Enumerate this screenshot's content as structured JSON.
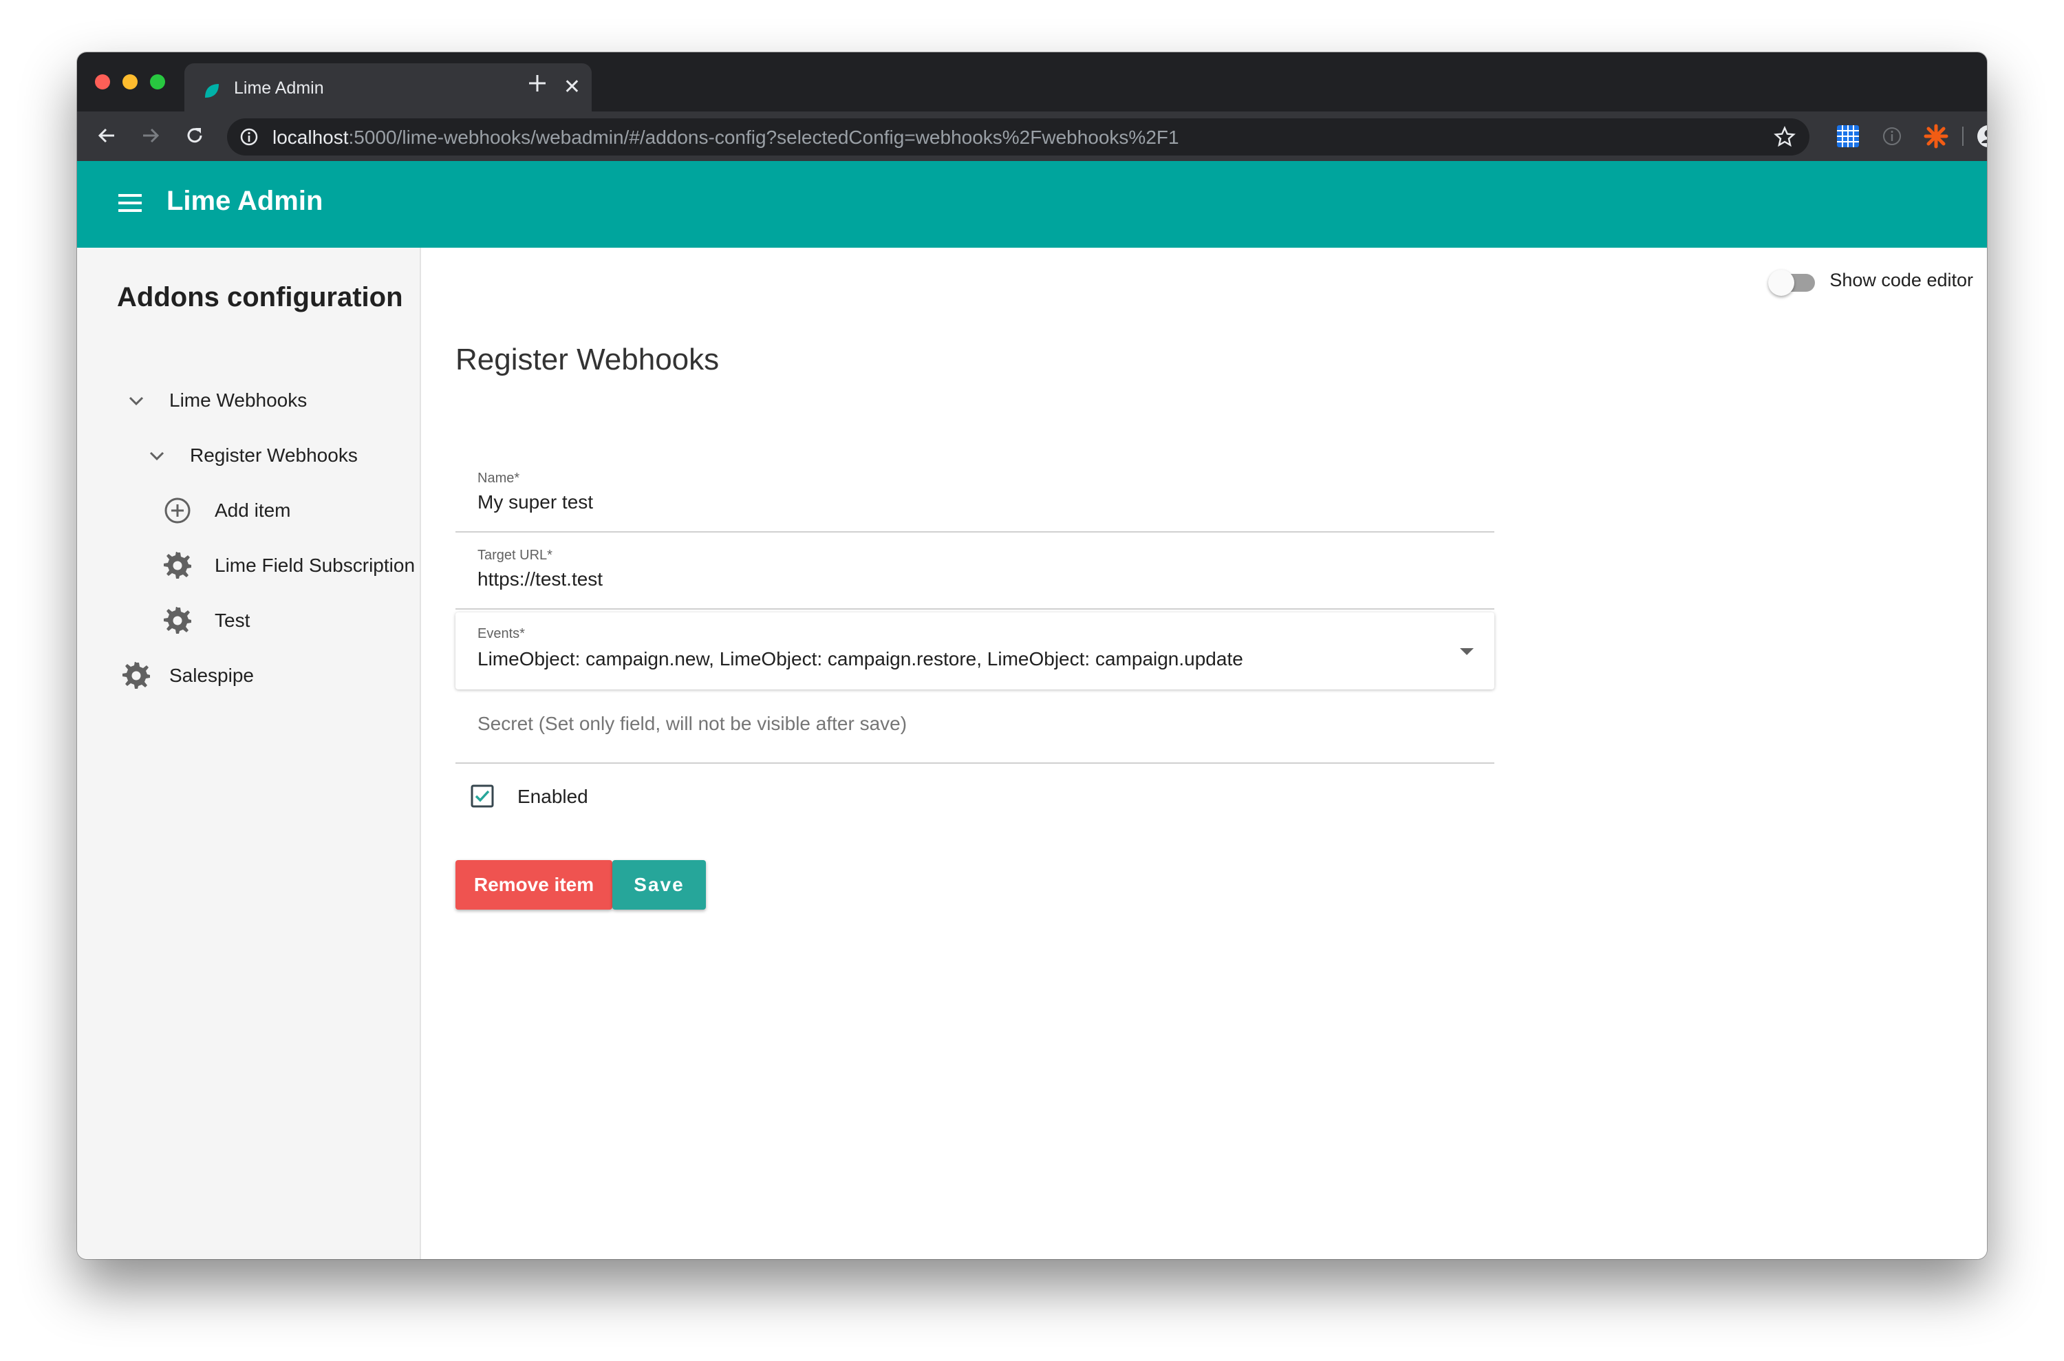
{
  "browser": {
    "tab_title": "Lime Admin",
    "tab_close": "✕",
    "url_host": "localhost",
    "url_rest": ":5000/lime-webhooks/webadmin/#/addons-config?selectedConfig=webhooks%2Fwebhooks%2F1"
  },
  "app": {
    "title": "Lime Admin"
  },
  "sidebar": {
    "title": "Addons configuration",
    "items": [
      {
        "label": "Lime Webhooks",
        "icon": "chevron-down-icon"
      },
      {
        "label": "Register Webhooks",
        "icon": "chevron-down-icon"
      },
      {
        "label": "Add item",
        "icon": "add-circle-icon"
      },
      {
        "label": "Lime Field Subscription",
        "icon": "gear-icon"
      },
      {
        "label": "Test",
        "icon": "gear-icon"
      },
      {
        "label": "Salespipe",
        "icon": "gear-icon"
      }
    ]
  },
  "main": {
    "code_editor_toggle": "Show code editor",
    "code_editor_on": false,
    "section_title": "Register Webhooks",
    "fields": {
      "name": {
        "label": "Name*",
        "value": "My super test"
      },
      "target_url": {
        "label": "Target URL*",
        "value": "https://test.test"
      },
      "events": {
        "label": "Events*",
        "value": "LimeObject: campaign.new, LimeObject: campaign.restore, LimeObject: campaign.update"
      },
      "secret": {
        "placeholder": "Secret (Set only field, will not be visible after save)"
      }
    },
    "enabled": {
      "label": "Enabled",
      "checked": true
    },
    "buttons": {
      "remove": "Remove item",
      "save": "Save"
    }
  },
  "colors": {
    "appbar": "#00a59d",
    "remove_button": "#ef5350",
    "save_button": "#26a69a",
    "checkbox": "#26a69a"
  }
}
